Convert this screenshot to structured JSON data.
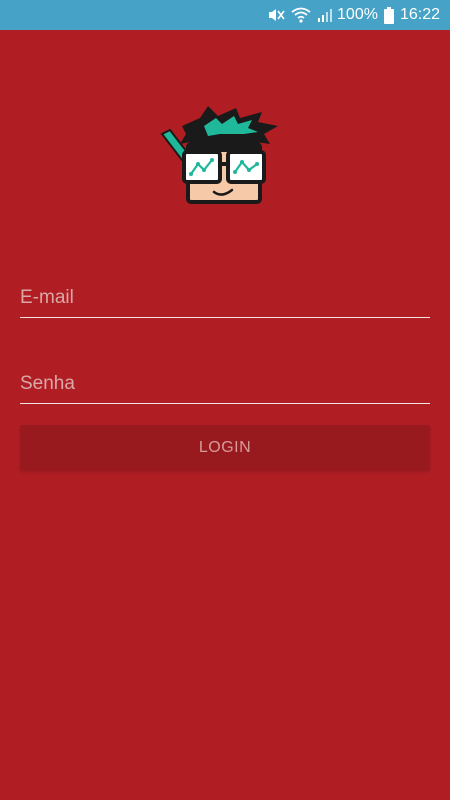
{
  "status_bar": {
    "battery_percent": "100%",
    "time": "16:22",
    "icons": [
      "mute-icon",
      "wifi-icon",
      "signal-icon",
      "battery-icon"
    ]
  },
  "login_form": {
    "email_placeholder": "E-mail",
    "email_value": "",
    "password_placeholder": "Senha",
    "password_value": "",
    "login_label": "LOGIN"
  },
  "colors": {
    "background": "#b01e24",
    "status_bar": "#46a3c7",
    "button": "#981a1f",
    "logo_hair_accent": "#1fb89a"
  },
  "logo": {
    "icon": "nerd-mascot-logo"
  }
}
